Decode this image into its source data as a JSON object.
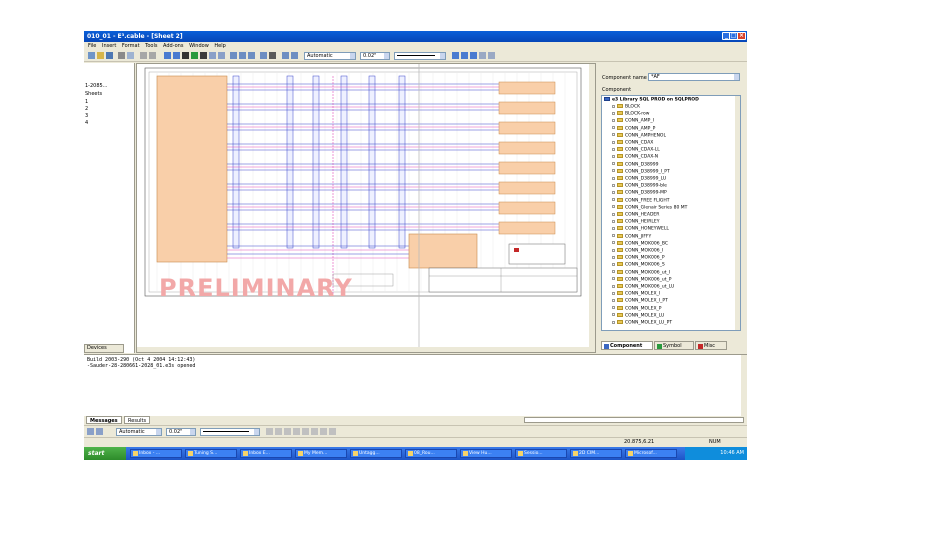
{
  "window": {
    "title": "010_01 - E³.cable - [Sheet 2]"
  },
  "menu": [
    "File",
    "Insert",
    "Format",
    "Tools",
    "Add-ons",
    "Window",
    "Help"
  ],
  "toolbar": {
    "zoom_select": "Automatic",
    "line_width": "0.02\""
  },
  "left_panel": {
    "rows": [
      "1-2085...",
      "Sheets",
      "1",
      "2",
      "3",
      "4"
    ],
    "tab": "Devices"
  },
  "sheet": {
    "watermark": "PRELIMINARY"
  },
  "right_panel": {
    "component_name_label": "Component name",
    "component_name_value": "*AF",
    "component_label": "Component",
    "root": "e3 Library SQL PROD on SQLPROD",
    "items": [
      "BLOCK",
      "BLOCK-row",
      "CONN_AMP_I",
      "CONN_AMP_P",
      "CONN_AMPHENOL",
      "CONN_CDAX",
      "CONN_CDAX-LL",
      "CONN_CDAX-N",
      "CONN_D38999",
      "CONN_D38999_I_PT",
      "CONN_D38999_LU",
      "CONN_D38999-ble",
      "CONN_D38999-MP",
      "CONN_FREE FLIGHT",
      "CONN_Glenair Series 80 MT",
      "CONN_HEADER",
      "CONN_HEIRLEY",
      "CONN_HONEYWELL",
      "CONN_JIFFY",
      "CONN_MOK006_BC",
      "CONN_MOK006_I",
      "CONN_MOK006_P",
      "CONN_MOK006_S",
      "CONN_MOK006_ut_I",
      "CONN_MOK006_ut_P",
      "CONN_MOK006_ut_LU",
      "CONN_MOLEX_I",
      "CONN_MOLEX_I_PT",
      "CONN_MOLEX_P",
      "CONN_MOLEX_LU",
      "CONN_MOLEX_LU_PT"
    ],
    "tabs": [
      "Component",
      "Symbol",
      "Misc"
    ]
  },
  "output": {
    "lines": [
      "Build 2003-290 (Oct  4 2004 14:12:43)",
      "-Sauder-28-280661-2028_01.e3s opened"
    ],
    "tabs": [
      "Messages",
      "Results"
    ]
  },
  "toolbar2": {
    "zoom_select": "Automatic",
    "line_width": "0.02\""
  },
  "status": {
    "coords": "20.875,6.21",
    "num": "NUM"
  },
  "taskbar": {
    "start": "start",
    "tasks": [
      "Inbox - ...",
      "Tuning S...",
      "Inbox E...",
      "My Mem...",
      "Untagg...",
      "08_Rou...",
      "View Hu...",
      "Sessio...",
      "2D CIM...",
      "Microsof..."
    ],
    "clock": "10:46 AM"
  },
  "colors": {
    "title": "#0a5fd8",
    "block": "#f9cfa9",
    "wire_blue": "#3a46c9",
    "wire_pink": "#e04fb8",
    "watermark": "#f2a8a8"
  }
}
